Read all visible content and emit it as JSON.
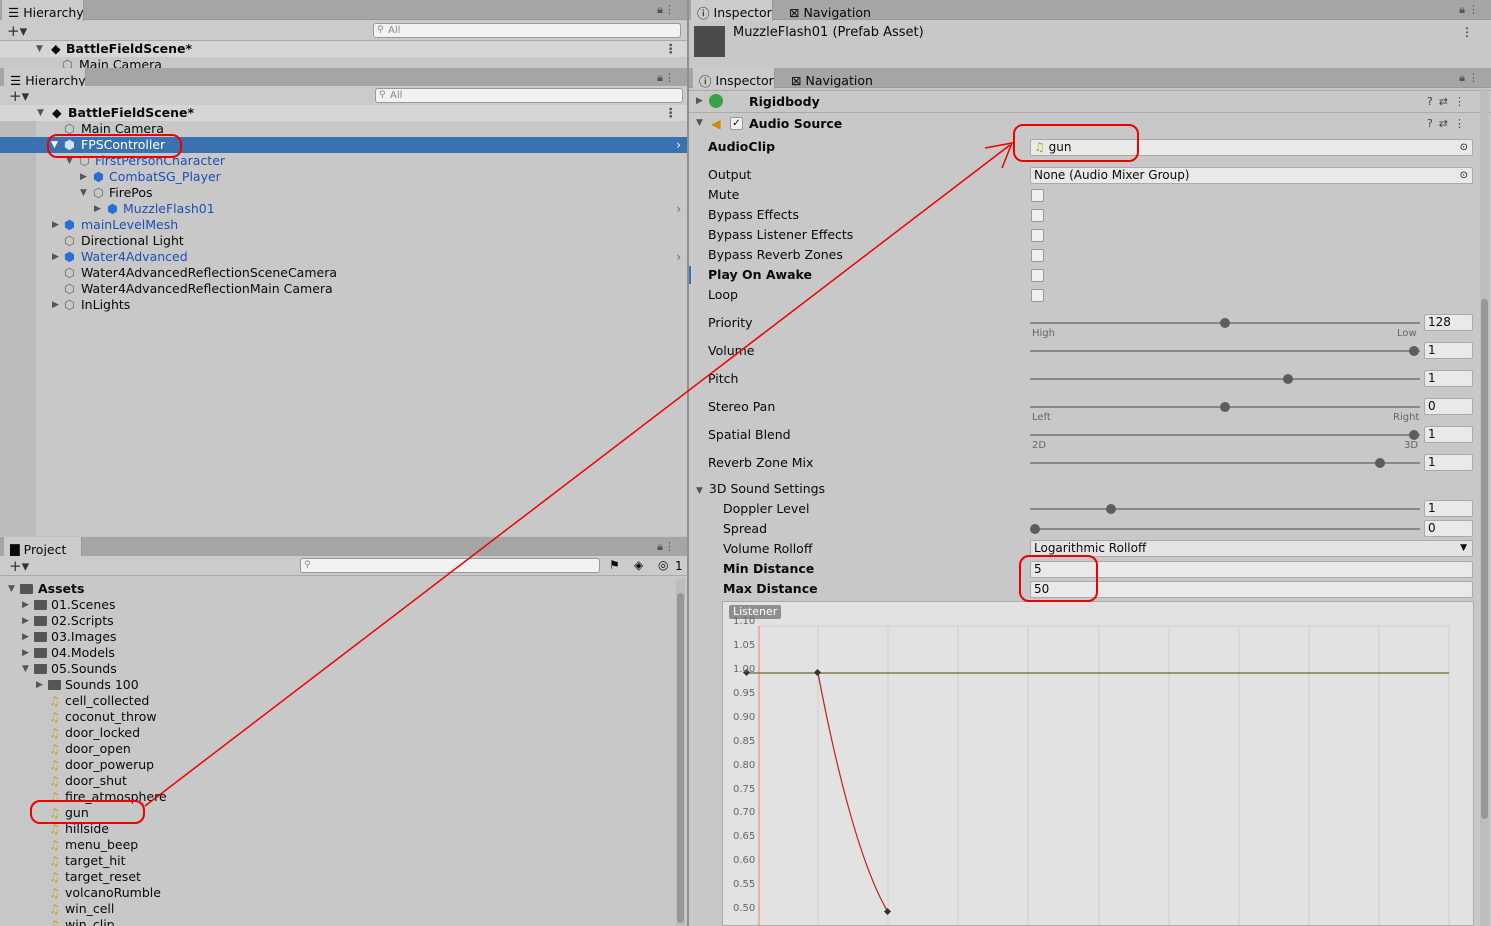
{
  "top_hierarchy": {
    "tab": "Hierarchy",
    "search_placeholder": "All",
    "scene": "BattleFieldScene*",
    "first_item": "Main Camera"
  },
  "hierarchy": {
    "tab": "Hierarchy",
    "search_placeholder": "All",
    "scene": "BattleFieldScene*",
    "items": [
      {
        "label": "Main Camera"
      },
      {
        "label": "FPSController"
      },
      {
        "label": "FirstPersonCharacter"
      },
      {
        "label": "CombatSG_Player"
      },
      {
        "label": "FirePos"
      },
      {
        "label": "MuzzleFlash01"
      },
      {
        "label": "mainLevelMesh"
      },
      {
        "label": "Directional Light"
      },
      {
        "label": "Water4Advanced"
      },
      {
        "label": "Water4AdvancedReflectionSceneCamera"
      },
      {
        "label": "Water4AdvancedReflectionMain Camera"
      },
      {
        "label": "InLights"
      }
    ]
  },
  "project": {
    "tab": "Project",
    "hidden_count": "1",
    "root": "Assets",
    "folders": [
      "01.Scenes",
      "02.Scripts",
      "03.Images",
      "04.Models",
      "05.Sounds",
      "Sounds 100"
    ],
    "files": [
      "cell_collected",
      "coconut_throw",
      "door_locked",
      "door_open",
      "door_powerup",
      "door_shut",
      "fire_atmosphere",
      "gun",
      "hillside",
      "menu_beep",
      "target_hit",
      "target_reset",
      "volcanoRumble",
      "win_cell",
      "win_clip"
    ]
  },
  "inspector_top": {
    "tab_inspector": "Inspector",
    "tab_navigation": "Navigation",
    "asset_title": "MuzzleFlash01 (Prefab Asset)"
  },
  "inspector": {
    "tab_inspector": "Inspector",
    "tab_navigation": "Navigation",
    "components": {
      "rigidbody": "Rigidbody",
      "audio_source": "Audio Source"
    },
    "props": {
      "audioclip": "AudioClip",
      "audioclip_value": "gun",
      "output": "Output",
      "output_value": "None (Audio Mixer Group)",
      "mute": "Mute",
      "bypass_effects": "Bypass Effects",
      "bypass_listener": "Bypass Listener Effects",
      "bypass_reverb": "Bypass Reverb Zones",
      "play_on_awake": "Play On Awake",
      "loop": "Loop",
      "priority": "Priority",
      "priority_value": "128",
      "priority_fraction": 0.5,
      "high": "High",
      "low": "Low",
      "volume": "Volume",
      "volume_value": "1",
      "pitch": "Pitch",
      "pitch_value": "1",
      "stereo_pan": "Stereo Pan",
      "stereo_value": "0",
      "left": "Left",
      "right": "Right",
      "spatial_blend": "Spatial Blend",
      "spatial_value": "1",
      "two_d": "2D",
      "three_d": "3D",
      "reverb_mix": "Reverb Zone Mix",
      "reverb_value": "1",
      "sound3d": "3D Sound Settings",
      "doppler": "Doppler Level",
      "doppler_value": "1",
      "spread": "Spread",
      "spread_value": "0",
      "rolloff": "Volume Rolloff",
      "rolloff_value": "Logarithmic Rolloff",
      "min_distance": "Min Distance",
      "min_value": "5",
      "max_distance": "Max Distance",
      "max_value": "50"
    },
    "graph": {
      "listener": "Listener",
      "y_ticks": [
        "1.10",
        "1.05",
        "1.00",
        "0.95",
        "0.90",
        "0.85",
        "0.80",
        "0.75",
        "0.70",
        "0.65",
        "0.60",
        "0.55",
        "0.50"
      ]
    }
  },
  "colors": {
    "selection": "#3a72b0",
    "annotation": "#e00000",
    "prefab_text": "#1e4fb3"
  }
}
